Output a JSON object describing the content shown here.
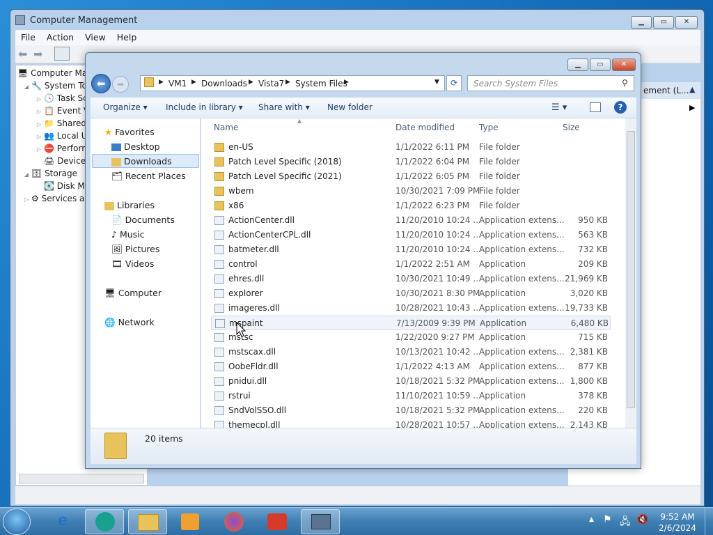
{
  "computer_management": {
    "title": "Computer Management",
    "menu": [
      "File",
      "Action",
      "View",
      "Help"
    ],
    "tree": {
      "root": "Computer Ma",
      "system_tools": "System To",
      "task_scheduler": "Task Sc",
      "event_viewer": "Event V",
      "shared_folders": "Shared",
      "local_users": "Local U",
      "performance": "Perforn",
      "device_manager": "Device",
      "storage": "Storage",
      "disk_management": "Disk M",
      "services": "Services an"
    },
    "actions_header": "ement (L..."
  },
  "explorer": {
    "address": [
      "VM1",
      "Downloads",
      "Vista7",
      "System Files"
    ],
    "search_placeholder": "Search System Files",
    "toolbar": {
      "organize": "Organize",
      "include": "Include in library",
      "share": "Share with",
      "new_folder": "New folder"
    },
    "nav": {
      "favorites": "Favorites",
      "desktop": "Desktop",
      "downloads": "Downloads",
      "recent": "Recent Places",
      "libraries": "Libraries",
      "documents": "Documents",
      "music": "Music",
      "pictures": "Pictures",
      "videos": "Videos",
      "computer": "Computer",
      "network": "Network"
    },
    "columns": {
      "name": "Name",
      "date": "Date modified",
      "type": "Type",
      "size": "Size"
    },
    "files": [
      {
        "name": "en-US",
        "date": "1/1/2022 6:11 PM",
        "type": "File folder",
        "size": ""
      },
      {
        "name": "Patch Level Specific (2018)",
        "date": "1/1/2022 6:04 PM",
        "type": "File folder",
        "size": ""
      },
      {
        "name": "Patch Level Specific (2021)",
        "date": "1/1/2022 6:05 PM",
        "type": "File folder",
        "size": ""
      },
      {
        "name": "wbem",
        "date": "10/30/2021 7:09 PM",
        "type": "File folder",
        "size": ""
      },
      {
        "name": "x86",
        "date": "1/1/2022 6:23 PM",
        "type": "File folder",
        "size": ""
      },
      {
        "name": "ActionCenter.dll",
        "date": "11/20/2010 10:24 ...",
        "type": "Application extens...",
        "size": "950 KB"
      },
      {
        "name": "ActionCenterCPL.dll",
        "date": "11/20/2010 10:24 ...",
        "type": "Application extens...",
        "size": "563 KB"
      },
      {
        "name": "batmeter.dll",
        "date": "11/20/2010 10:24 ...",
        "type": "Application extens...",
        "size": "732 KB"
      },
      {
        "name": "control",
        "date": "1/1/2022 2:51 AM",
        "type": "Application",
        "size": "209 KB"
      },
      {
        "name": "ehres.dll",
        "date": "10/30/2021 10:49 ...",
        "type": "Application extens...",
        "size": "21,969 KB"
      },
      {
        "name": "explorer",
        "date": "10/30/2021 8:30 PM",
        "type": "Application",
        "size": "3,020 KB"
      },
      {
        "name": "imageres.dll",
        "date": "10/28/2021 10:43 ...",
        "type": "Application extens...",
        "size": "19,733 KB"
      },
      {
        "name": "mspaint",
        "date": "7/13/2009 9:39 PM",
        "type": "Application",
        "size": "6,480 KB"
      },
      {
        "name": "mstsc",
        "date": "1/22/2020 9:27 PM",
        "type": "Application",
        "size": "715 KB"
      },
      {
        "name": "mstscax.dll",
        "date": "10/13/2021 10:42 ...",
        "type": "Application extens...",
        "size": "2,381 KB"
      },
      {
        "name": "OobeFldr.dll",
        "date": "1/1/2022 4:13 AM",
        "type": "Application extens...",
        "size": "877 KB"
      },
      {
        "name": "pnidui.dll",
        "date": "10/18/2021 5:32 PM",
        "type": "Application extens...",
        "size": "1,800 KB"
      },
      {
        "name": "rstrui",
        "date": "11/10/2021 10:59 ...",
        "type": "Application",
        "size": "378 KB"
      },
      {
        "name": "SndVolSSO.dll",
        "date": "10/18/2021 5:32 PM",
        "type": "Application extens...",
        "size": "220 KB"
      },
      {
        "name": "themecpl.dll",
        "date": "10/28/2021 10:57 ...",
        "type": "Application extens...",
        "size": "2,143 KB"
      }
    ],
    "item_count": "20 items"
  },
  "clock": {
    "time": "9:52 AM",
    "date": "2/6/2024"
  },
  "colors": {
    "folder": "#e8c25a",
    "accent": "#3f7fb3"
  }
}
